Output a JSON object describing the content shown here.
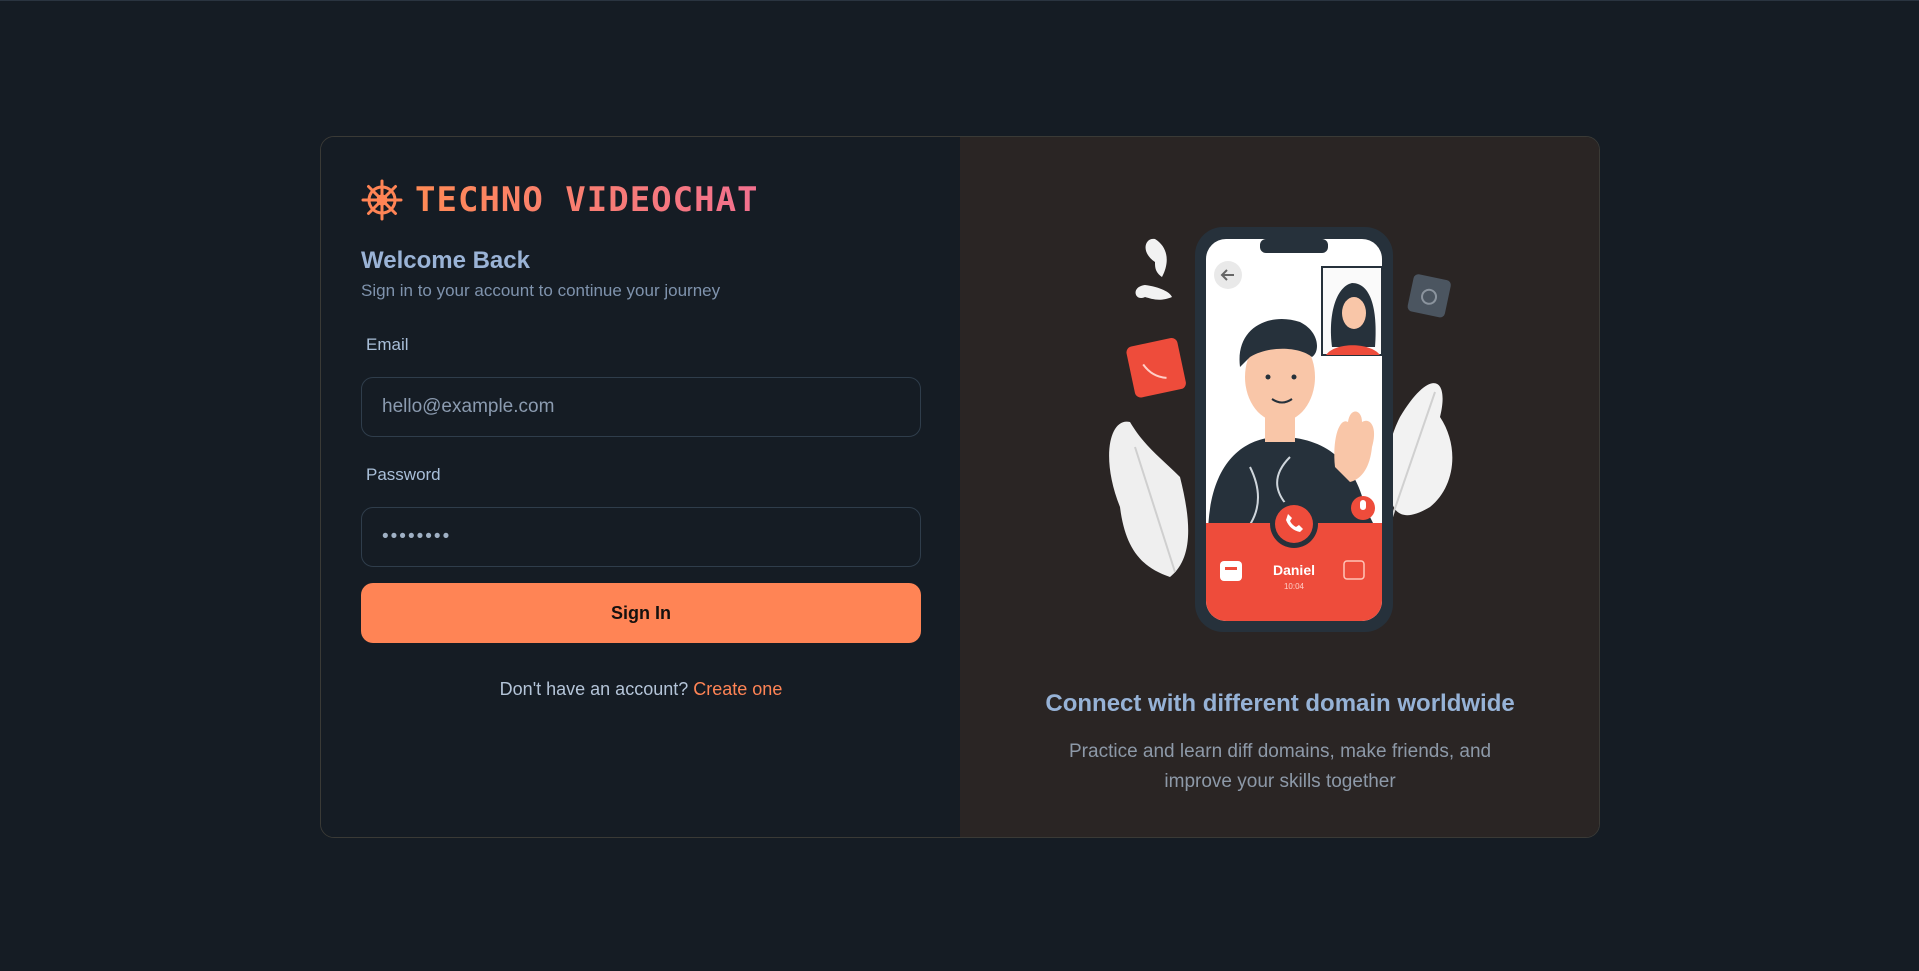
{
  "brand": {
    "name": "TECHNO VIDEOCHAT",
    "icon": "ship-wheel-icon"
  },
  "login": {
    "title": "Welcome Back",
    "subtitle": "Sign in to your account to continue your journey",
    "email_label": "Email",
    "email_placeholder": "hello@example.com",
    "password_label": "Password",
    "password_value": "••••••••",
    "signin_label": "Sign In",
    "signup_prompt": "Don't have an account?",
    "signup_link": "Create one"
  },
  "promo": {
    "title": "Connect with different domain worldwide",
    "text": "Practice and learn diff domains, make friends, and improve your skills together",
    "caller_name": "Daniel",
    "call_time": "10:04"
  },
  "colors": {
    "accent": "#ff8455",
    "background": "#151c24",
    "panel_right": "#2a2524",
    "call_red": "#ee4c3b"
  }
}
